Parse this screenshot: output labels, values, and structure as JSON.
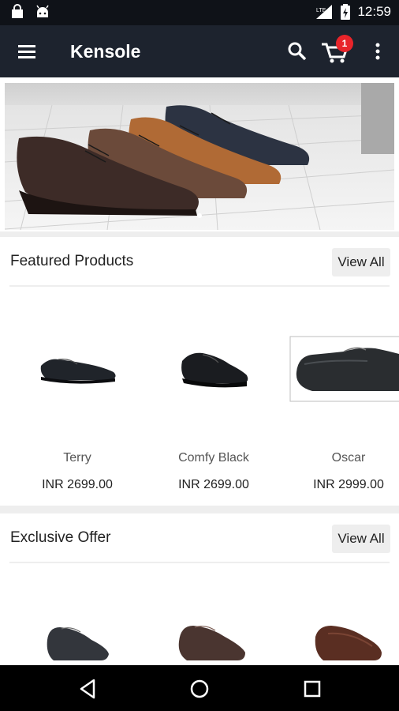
{
  "status_bar": {
    "time": "12:59",
    "network": "LTE"
  },
  "app_bar": {
    "title": "Kensole",
    "cart_count": "1"
  },
  "sections": {
    "featured": {
      "title": "Featured Products",
      "view_all": "View All",
      "products": [
        {
          "name": "Terry",
          "price": "INR 2699.00"
        },
        {
          "name": "Comfy Black",
          "price": "INR 2699.00"
        },
        {
          "name": "Oscar",
          "price": "INR 2999.00"
        }
      ]
    },
    "exclusive": {
      "title": "Exclusive Offer",
      "view_all": "View All"
    }
  },
  "colors": {
    "status_bar": "#0f1218",
    "app_bar": "#1d232e",
    "badge": "#e8242a",
    "nav_bar": "#000000"
  }
}
